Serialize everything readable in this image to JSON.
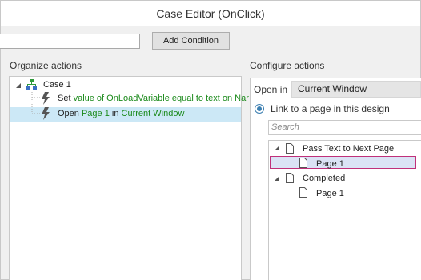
{
  "window": {
    "title": "Case Editor (OnClick)"
  },
  "condition": {
    "input_value": "",
    "button_label": "Add Condition"
  },
  "organize": {
    "heading": "Organize actions",
    "case_label": "Case 1",
    "action1": {
      "prefix": "Set ",
      "detail": "value of OnLoadVariable equal to text on Nar"
    },
    "action2": {
      "prefix": "Open ",
      "page": "Page 1",
      "mid": " in ",
      "target": "Current Window"
    }
  },
  "configure": {
    "heading": "Configure actions",
    "open_in_label": "Open in",
    "open_in_value": "Current Window",
    "radio_label": "Link to a page in this design",
    "search_placeholder": "Search",
    "pages": [
      {
        "label": "Pass Text to Next Page"
      },
      {
        "label": "Page 1"
      },
      {
        "label": "Completed"
      },
      {
        "label": "Page 1"
      }
    ]
  },
  "colors": {
    "selection": "#cce8f6",
    "accent_green": "#1b8a1b",
    "page_highlight": "#c0307a"
  }
}
